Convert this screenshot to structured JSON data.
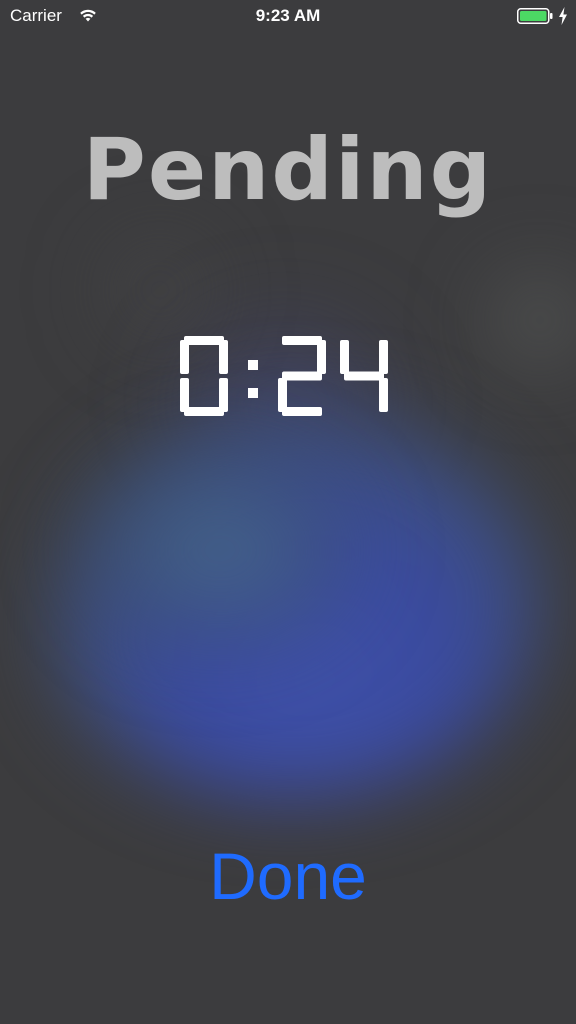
{
  "status_bar": {
    "carrier": "Carrier",
    "time": "9:23 AM",
    "battery_color": "#4cd964"
  },
  "title": "Pending",
  "timer": {
    "display": "0:24",
    "color": "#ffffff"
  },
  "done_label": "Done",
  "colors": {
    "background": "#3c3c3e",
    "title": "#bdbdbd",
    "accent": "#1f6bff"
  }
}
